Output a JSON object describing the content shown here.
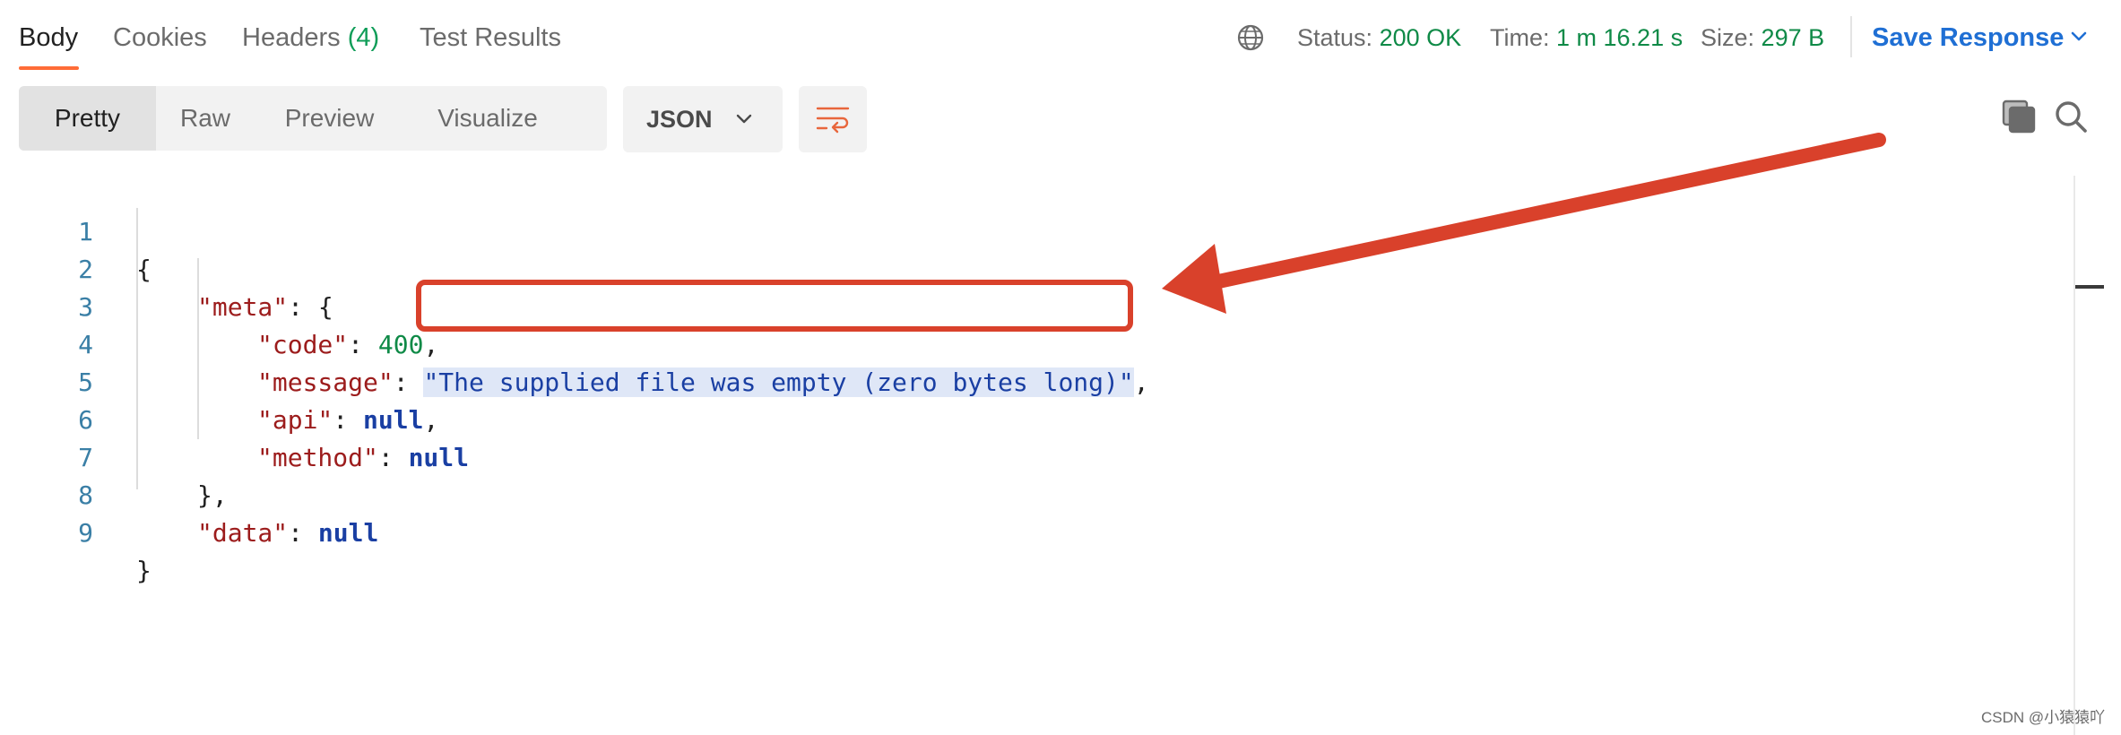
{
  "tabs": [
    {
      "label": "Body"
    },
    {
      "label": "Cookies"
    },
    {
      "label": "Headers",
      "count": "(4)"
    },
    {
      "label": "Test Results"
    }
  ],
  "status": {
    "status_label": "Status:",
    "status_value": "200 OK",
    "time_label": "Time:",
    "time_value": "1 m 16.21 s",
    "size_label": "Size:",
    "size_value": "297 B"
  },
  "save_response_label": "Save Response",
  "view_modes": [
    "Pretty",
    "Raw",
    "Preview",
    "Visualize"
  ],
  "active_view_mode": "Pretty",
  "format_select": "JSON",
  "icons": {
    "globe": "globe-icon",
    "chevron": "chevron-down-icon",
    "wrap": "wrap-lines-icon",
    "copy": "copy-icon",
    "search": "search-icon",
    "annotation_arrow": "arrow-icon"
  },
  "code": {
    "line_numbers": [
      "1",
      "2",
      "3",
      "4",
      "5",
      "6",
      "7",
      "8",
      "9"
    ],
    "l1": "{",
    "l2_key": "\"meta\"",
    "l2_rest": ": {",
    "l3_key": "\"code\"",
    "l3_sep": ": ",
    "l3_val": "400",
    "l3_end": ",",
    "l4_key": "\"message\"",
    "l4_sep": ": ",
    "l4_val": "\"The supplied file was empty (zero bytes long)\"",
    "l4_end": ",",
    "l5_key": "\"api\"",
    "l5_sep": ": ",
    "l5_val": "null",
    "l5_end": ",",
    "l6_key": "\"method\"",
    "l6_sep": ": ",
    "l6_val": "null",
    "l7": "},",
    "l8_key": "\"data\"",
    "l8_sep": ": ",
    "l8_val": "null",
    "l9": "}"
  },
  "colors": {
    "accent_tab": "#ff6c37",
    "status_green": "#0f8a47",
    "link_blue": "#1f6fd4",
    "annotation_red": "#d9412b"
  },
  "footer_credit": "CSDN @小猿猿吖"
}
